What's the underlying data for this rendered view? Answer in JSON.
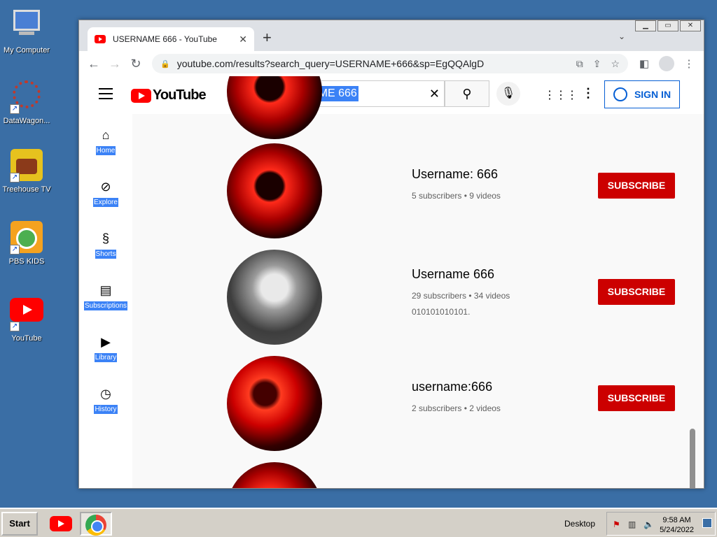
{
  "desktop": {
    "icons": [
      {
        "label": "My Computer",
        "icon": "computer-icon"
      },
      {
        "label": "DataWagon...",
        "icon": "datawagon-icon"
      },
      {
        "label": "Treehouse TV",
        "icon": "treehouse-icon"
      },
      {
        "label": "PBS KIDS",
        "icon": "pbs-kids-icon"
      },
      {
        "label": "YouTube",
        "icon": "youtube-icon"
      }
    ]
  },
  "browser": {
    "tab_title": "USERNAME 666 - YouTube",
    "url": "youtube.com/results?search_query=USERNAME+666&sp=EgQQAlgD"
  },
  "youtube": {
    "logo_text": "YouTube",
    "search_query": "USERNAME 666",
    "sign_in_label": "SIGN IN",
    "nav": [
      {
        "label": "Home",
        "icon": "home-icon"
      },
      {
        "label": "Explore",
        "icon": "explore-icon"
      },
      {
        "label": "Shorts",
        "icon": "shorts-icon"
      },
      {
        "label": "Subscriptions",
        "icon": "subscriptions-icon"
      },
      {
        "label": "Library",
        "icon": "library-icon"
      },
      {
        "label": "History",
        "icon": "history-icon"
      }
    ],
    "channels": [
      {
        "name": "Username: 666",
        "meta": "5 subscribers • 9 videos",
        "description": "",
        "subscribe_label": "SUBSCRIBE"
      },
      {
        "name": "Username 666",
        "meta": "29 subscribers • 34 videos",
        "description": "010101010101.",
        "subscribe_label": "SUBSCRIBE"
      },
      {
        "name": "username:666",
        "meta": "2 subscribers • 2 videos",
        "description": "",
        "subscribe_label": "SUBSCRIBE"
      }
    ]
  },
  "taskbar": {
    "start_label": "Start",
    "desktop_label": "Desktop",
    "time": "9:58 AM",
    "date": "5/24/2022"
  }
}
